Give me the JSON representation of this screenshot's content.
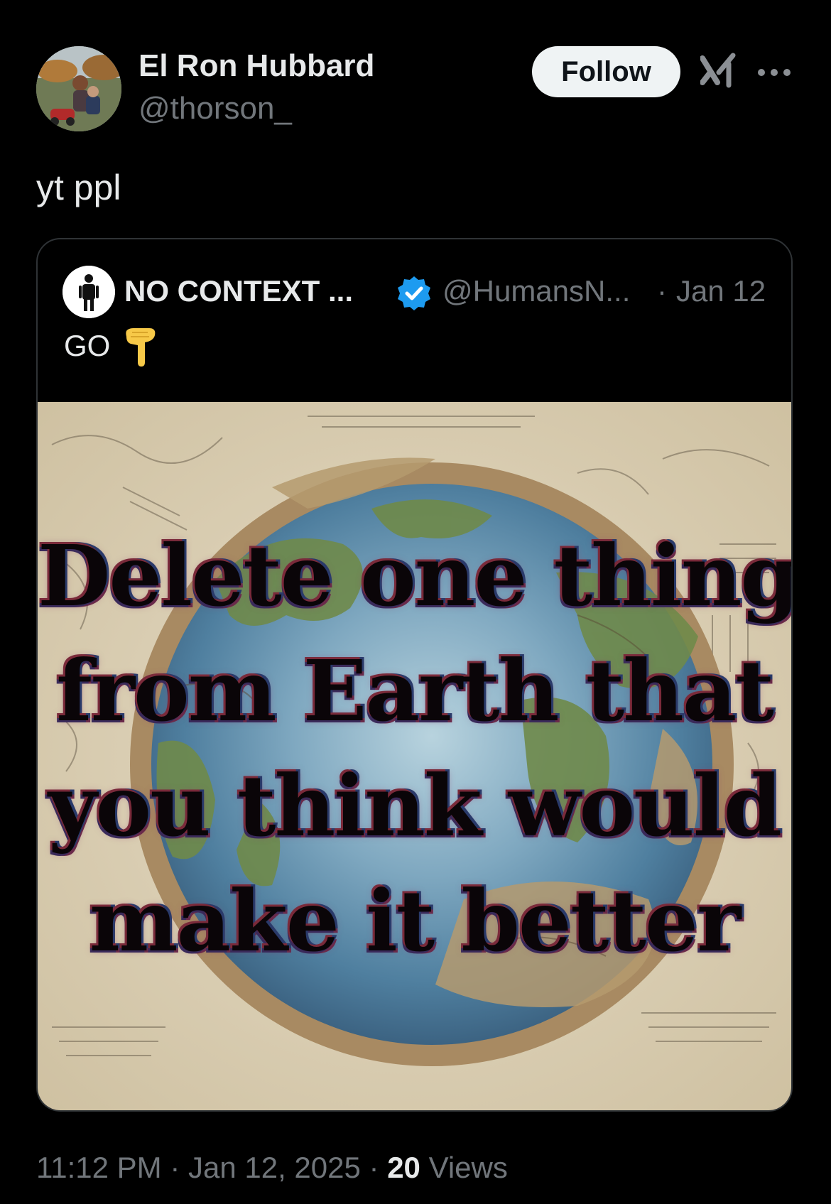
{
  "author": {
    "display_name": "El Ron Hubbard",
    "handle": "@thorson_"
  },
  "actions": {
    "follow_label": "Follow",
    "grok_icon": "grok-icon",
    "more_icon": "more-icon"
  },
  "tweet": {
    "text": "yt ppl"
  },
  "quote": {
    "name": "NO CONTEXT ...",
    "verified_icon": "verified-badge-icon",
    "handle": "@HumansN...",
    "separator": "·",
    "date": "Jan 12",
    "text": "GO",
    "emoji": "pointing-down-emoji",
    "media": {
      "caption_lines": [
        "Delete one thing",
        "from Earth that",
        "you think would",
        "make it better"
      ]
    }
  },
  "footer": {
    "time": "11:12 PM",
    "sep1": " · ",
    "date": "Jan 12, 2025",
    "sep2": " · ",
    "views_count": "20",
    "views_label": " Views"
  },
  "colors": {
    "background": "#000000",
    "primary_text": "#e7e9ea",
    "secondary_text": "#71767b",
    "border": "#2f3336",
    "verified_blue": "#1d9bf0",
    "follow_button_bg": "#eff3f4"
  }
}
